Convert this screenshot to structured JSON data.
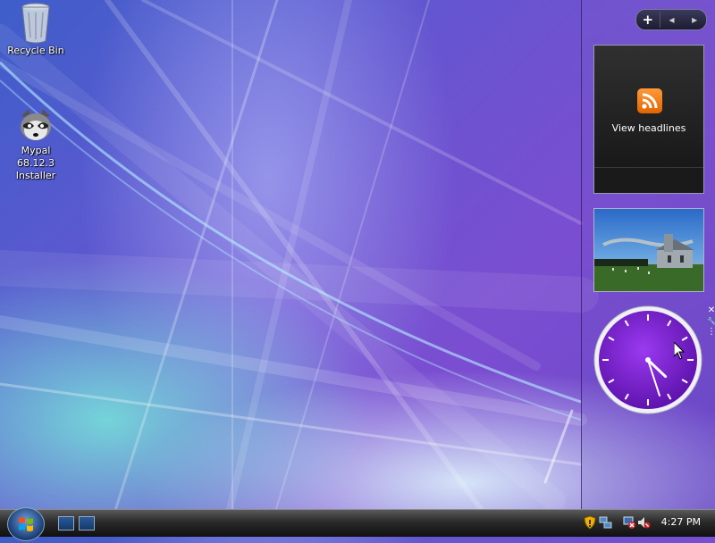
{
  "desktop": {
    "icons": [
      {
        "label": "Recycle Bin",
        "icon": "recycle-bin-icon"
      },
      {
        "label": "Mypal 68.12.3 Installer",
        "label_lines": [
          "Mypal 68.12.3",
          "Installer"
        ],
        "icon": "raccoon-installer-icon"
      }
    ]
  },
  "sidebar": {
    "controls": {
      "add": "+",
      "prev": "◂",
      "next": "▸"
    },
    "feed_gadget": {
      "label": "View headlines",
      "icon": "rss-icon"
    },
    "slideshow_gadget": {
      "icon": "church-photo"
    },
    "clock_gadget": {
      "hour": 4,
      "minute": 27,
      "tools": {
        "close": "✕",
        "settings": "🔧"
      }
    }
  },
  "taskbar": {
    "start": {
      "icon": "windows-orb-icon"
    },
    "quick_launch": [
      {
        "icon": "show-desktop-icon"
      },
      {
        "icon": "switch-windows-icon"
      }
    ],
    "tray": [
      {
        "icon": "security-shield-icon"
      },
      {
        "icon": "network-computers-icon"
      },
      {
        "icon": "network-disconnected-icon"
      },
      {
        "icon": "volume-muted-icon"
      }
    ],
    "time": "4:27 PM"
  },
  "colors": {
    "clock_face": "#7a1ecf",
    "rss": "#f28a1a"
  }
}
